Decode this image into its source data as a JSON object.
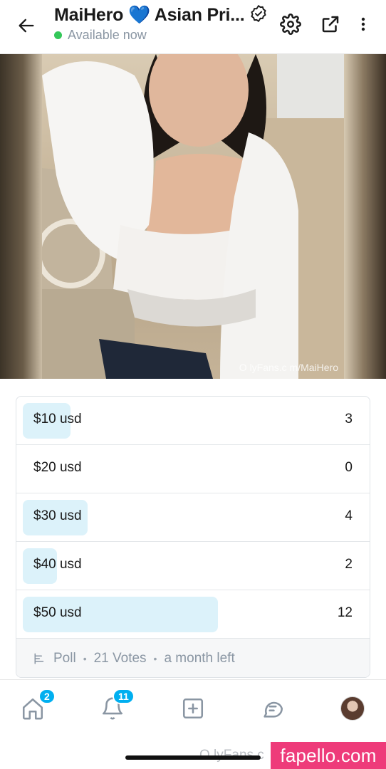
{
  "header": {
    "title": "MaiHero 💙 Asian Pri...",
    "status": "Available now"
  },
  "media": {
    "watermark": "O lyFans.c m/MaiHero"
  },
  "poll": {
    "options": [
      {
        "label": "$10 usd",
        "votes": "3",
        "share": 0.14
      },
      {
        "label": "$20 usd",
        "votes": "0",
        "share": 0.0
      },
      {
        "label": "$30 usd",
        "votes": "4",
        "share": 0.19
      },
      {
        "label": "$40 usd",
        "votes": "2",
        "share": 0.1
      },
      {
        "label": "$50 usd",
        "votes": "12",
        "share": 0.57
      }
    ],
    "footer": {
      "type": "Poll",
      "votes": "21 Votes",
      "time_left": "a month left"
    }
  },
  "nav": {
    "home_badge": "2",
    "notifications_badge": "11"
  },
  "overlay": {
    "bottom_watermark": "O lyFans.c",
    "site_badge": "fapello.com"
  },
  "colors": {
    "accent": "#00aff0",
    "poll_bar": "#dcf2fa",
    "online": "#34c759",
    "site_badge": "#ee3b7a"
  }
}
